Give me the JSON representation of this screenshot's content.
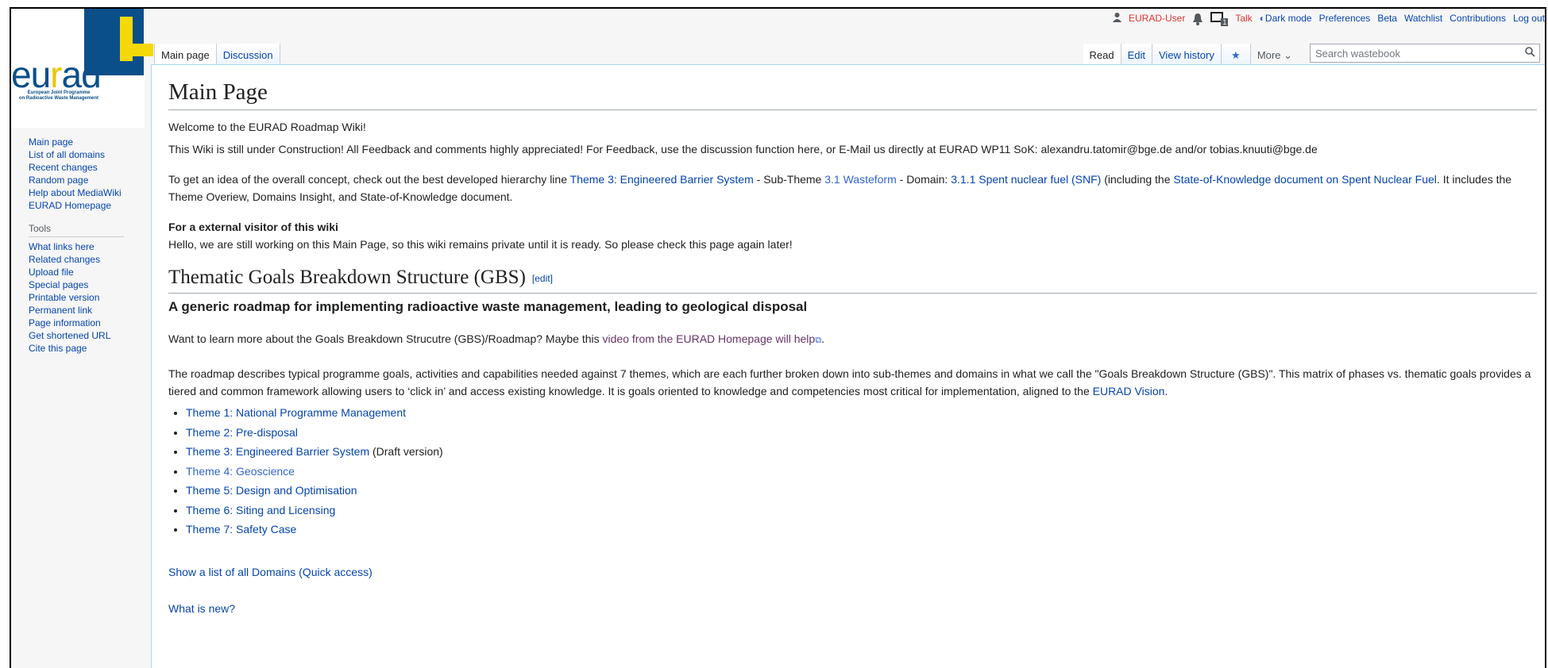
{
  "logo": {
    "main_left": "eu",
    "main_mid": "r",
    "main_right": "ad",
    "sub_line1": "European Joint Programme",
    "sub_line2": "on Radioactive Waste Management"
  },
  "personal": {
    "user": "EURAD-User",
    "talk": "Talk",
    "dark_mode": "Dark mode",
    "preferences": "Preferences",
    "beta": "Beta",
    "watchlist": "Watchlist",
    "contributions": "Contributions",
    "logout": "Log out",
    "notif_count": "1"
  },
  "tabs": {
    "main_page": "Main page",
    "discussion": "Discussion",
    "read": "Read",
    "edit": "Edit",
    "view_history": "View history",
    "more": "More"
  },
  "search": {
    "placeholder": "Search wastebook"
  },
  "sidebar": {
    "nav": [
      "Main page",
      "List of all domains",
      "Recent changes",
      "Random page",
      "Help about MediaWiki",
      "EURAD Homepage"
    ],
    "tools_heading": "Tools",
    "tools": [
      "What links here",
      "Related changes",
      "Upload file",
      "Special pages",
      "Printable version",
      "Permanent link",
      "Page information",
      "Get shortened URL",
      "Cite this page"
    ]
  },
  "content": {
    "title": "Main Page",
    "welcome": "Welcome to the EURAD Roadmap Wiki!",
    "construction": "This Wiki is still under Construction! All Feedback and comments highly appreciated! For Feedback, use the discussion function here, or E-Mail us directly at EURAD WP11 SoK: alexandru.tatomir@bge.de and/or tobias.knuuti@bge.de",
    "concept_1": "To get an idea of the overall concept, check out the best developed hierarchy line ",
    "concept_link1": "Theme 3: Engineered Barrier System",
    "concept_2": " - Sub-Theme ",
    "concept_link2": "3.1 Wasteform",
    "concept_3": " - Domain: ",
    "concept_link3": "3.1.1 Spent nuclear fuel (SNF)",
    "concept_4": " (including the ",
    "concept_link4": "State-of-Knowledge document on Spent Nuclear Fuel",
    "concept_5": ". It includes the Theme Overiew, Domains Insight, and State-of-Knowledge document.",
    "visitor_heading": "For a external visitor of this wiki",
    "visitor_text": "Hello, we are still working on this Main Page, so this wiki remains private until it is ready. So please check this page again later!",
    "gbs_heading": "Thematic Goals Breakdown Structure (GBS)",
    "edit_link": "[edit]",
    "gbs_subheading": "A generic roadmap for implementing radioactive waste management, leading to geological disposal",
    "learn_1": "Want to learn more about the Goals Breakdown Strucutre (GBS)/Roadmap? Maybe this ",
    "learn_link": "video from the EURAD Homepage will help",
    "learn_2": ".",
    "roadmap_1": "The roadmap describes typical programme goals, activities and capabilities needed against 7 themes, which are each further broken down into sub-themes and domains in what we call the \"Goals Breakdown Structure (GBS)\". This matrix of phases vs. thematic goals provides a tiered and common framework allowing users to ‘click in’ and access existing knowledge. It is goals oriented to knowledge and competencies most critical for implementation, aligned to the ",
    "roadmap_link": "EURAD Vision",
    "roadmap_2": ".",
    "themes": [
      {
        "label": "Theme 1: National Programme Management",
        "suffix": ""
      },
      {
        "label": "Theme 2: Pre-disposal",
        "suffix": ""
      },
      {
        "label": "Theme 3: Engineered Barrier System",
        "suffix": " (Draft version)"
      },
      {
        "label": "Theme 4: Geoscience",
        "suffix": ""
      },
      {
        "label": "Theme 5: Design and Optimisation",
        "suffix": ""
      },
      {
        "label": "Theme 6: Siting and Licensing",
        "suffix": ""
      },
      {
        "label": "Theme 7: Safety Case",
        "suffix": ""
      }
    ],
    "quick_access": "Show a list of all Domains (Quick access)",
    "what_new": "What is new?"
  },
  "colors": {
    "link": "#0645ad",
    "red_link": "#dd3333",
    "visited": "#663366",
    "logo_blue": "#0b4f8a",
    "logo_yellow": "#f5d80a"
  }
}
